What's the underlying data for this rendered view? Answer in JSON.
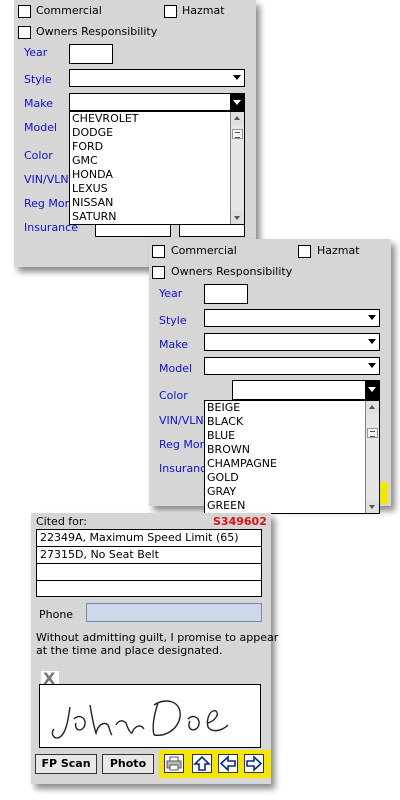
{
  "panel1": {
    "commercial": "Commercial",
    "hazmat": "Hazmat",
    "owners": "Owners Responsibility",
    "year": "Year",
    "style": "Style",
    "make": "Make",
    "model": "Model",
    "color": "Color",
    "vin": "VIN/VLN",
    "reg": "Reg Mon",
    "insurance": "Insurance",
    "make_options": [
      "CHEVROLET",
      "DODGE",
      "FORD",
      "GMC",
      "HONDA",
      "LEXUS",
      "NISSAN",
      "SATURN"
    ]
  },
  "panel2": {
    "commercial": "Commercial",
    "hazmat": "Hazmat",
    "owners": "Owners Responsibility",
    "year": "Year",
    "style": "Style",
    "make": "Make",
    "model": "Model",
    "color": "Color",
    "vin": "VIN/VLN",
    "reg": "Reg Mon",
    "insurance": "Insurance",
    "color_options": [
      "BEIGE",
      "BLACK",
      "BLUE",
      "BROWN",
      "CHAMPAGNE",
      "GOLD",
      "GRAY",
      "GREEN"
    ]
  },
  "panel3": {
    "cited_for": "Cited for:",
    "citation_number": "S349602",
    "violations": [
      "22349A, Maximum Speed Limit (65)",
      "27315D, No Seat Belt",
      "",
      ""
    ],
    "phone_label": "Phone",
    "phone_value": "",
    "promise_line1": "Without admitting guilt, I promise to appear",
    "promise_line2": "at the time and place designated.",
    "clear_glyph": "X",
    "fp_scan": "FP Scan",
    "photo": "Photo"
  },
  "colors": {
    "panel_bg": "#d6d6d6",
    "label_blue": "#1010d0",
    "citation_red": "#e01010",
    "highlight_yellow": "#f5e600",
    "phone_bg": "#cdd9ea"
  }
}
